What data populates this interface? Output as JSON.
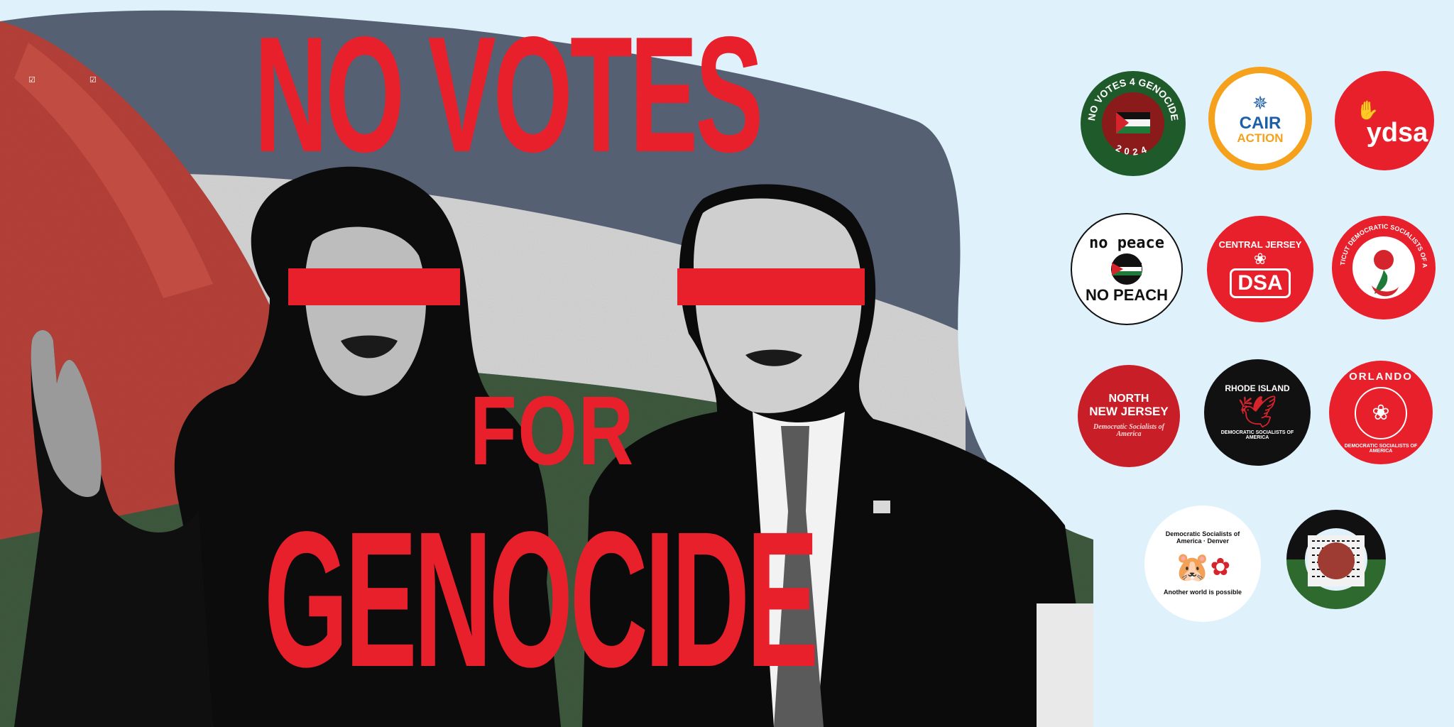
{
  "headline": {
    "line1": "NO VOTES",
    "line2": "FOR",
    "line3": "GENOCIDE"
  },
  "colors": {
    "accent_red": "#e8202c",
    "background": "#dff1fb",
    "flag_green": "#1f5a2b",
    "cair_orange": "#f5a11c",
    "cair_blue": "#1f5fa8"
  },
  "logos": [
    {
      "id": "no-votes-4-genocide",
      "text_top": "NO VOTES 4 GENOCIDE",
      "text_bottom": "2024"
    },
    {
      "id": "cair-action",
      "line1": "CAIR",
      "line2": "ACTION"
    },
    {
      "id": "ydsa",
      "text": "ydsa"
    },
    {
      "id": "no-peace-no-peach",
      "line1": "no peace",
      "line2": "NO PEACH"
    },
    {
      "id": "central-jersey-dsa",
      "line1": "CENTRAL JERSEY",
      "line2": "DSA"
    },
    {
      "id": "connecticut-dsa",
      "text": "CONNECTICUT DEMOCRATIC SOCIALISTS OF AMERICA"
    },
    {
      "id": "north-new-jersey-dsa",
      "line1": "NORTH",
      "line2": "NEW JERSEY",
      "line3": "Democratic Socialists of America"
    },
    {
      "id": "rhode-island-dsa",
      "line1": "RHODE ISLAND",
      "line2": "DEMOCRATIC SOCIALISTS OF AMERICA"
    },
    {
      "id": "orlando-dsa",
      "line1": "ORLANDO",
      "line2": "DEMOCRATIC SOCIALISTS OF AMERICA"
    },
    {
      "id": "denver-dsa",
      "line1": "Democratic Socialists of America · Denver",
      "line2": "Another world is possible"
    },
    {
      "id": "black-palestinian-emblem"
    }
  ]
}
